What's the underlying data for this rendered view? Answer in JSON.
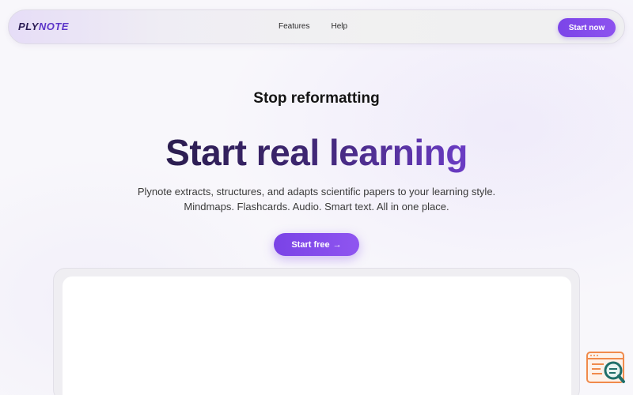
{
  "navbar": {
    "logo_part1": "PLY",
    "logo_part2": "NOTE",
    "links": [
      {
        "label": "Features"
      },
      {
        "label": "Help"
      }
    ],
    "cta_label": "Start now"
  },
  "hero": {
    "eyebrow": "Stop reformatting",
    "headline": "Start real learning",
    "subtext": "Plynote extracts, structures, and adapts scientific papers to your learning style. Mindmaps. Flashcards. Audio. Smart text. All in one place.",
    "cta_label": "Start free",
    "cta_arrow": "→"
  },
  "widget": {
    "icon": "document-search-icon"
  },
  "colors": {
    "accent": "#7b45e8",
    "logo_dark": "#2b1d55",
    "logo_accent": "#5c35c9",
    "headline_dark": "#2b1d4f",
    "headline_light": "#6b3cc5",
    "widget_orange": "#f08a4b",
    "widget_teal": "#1f6f6a"
  }
}
